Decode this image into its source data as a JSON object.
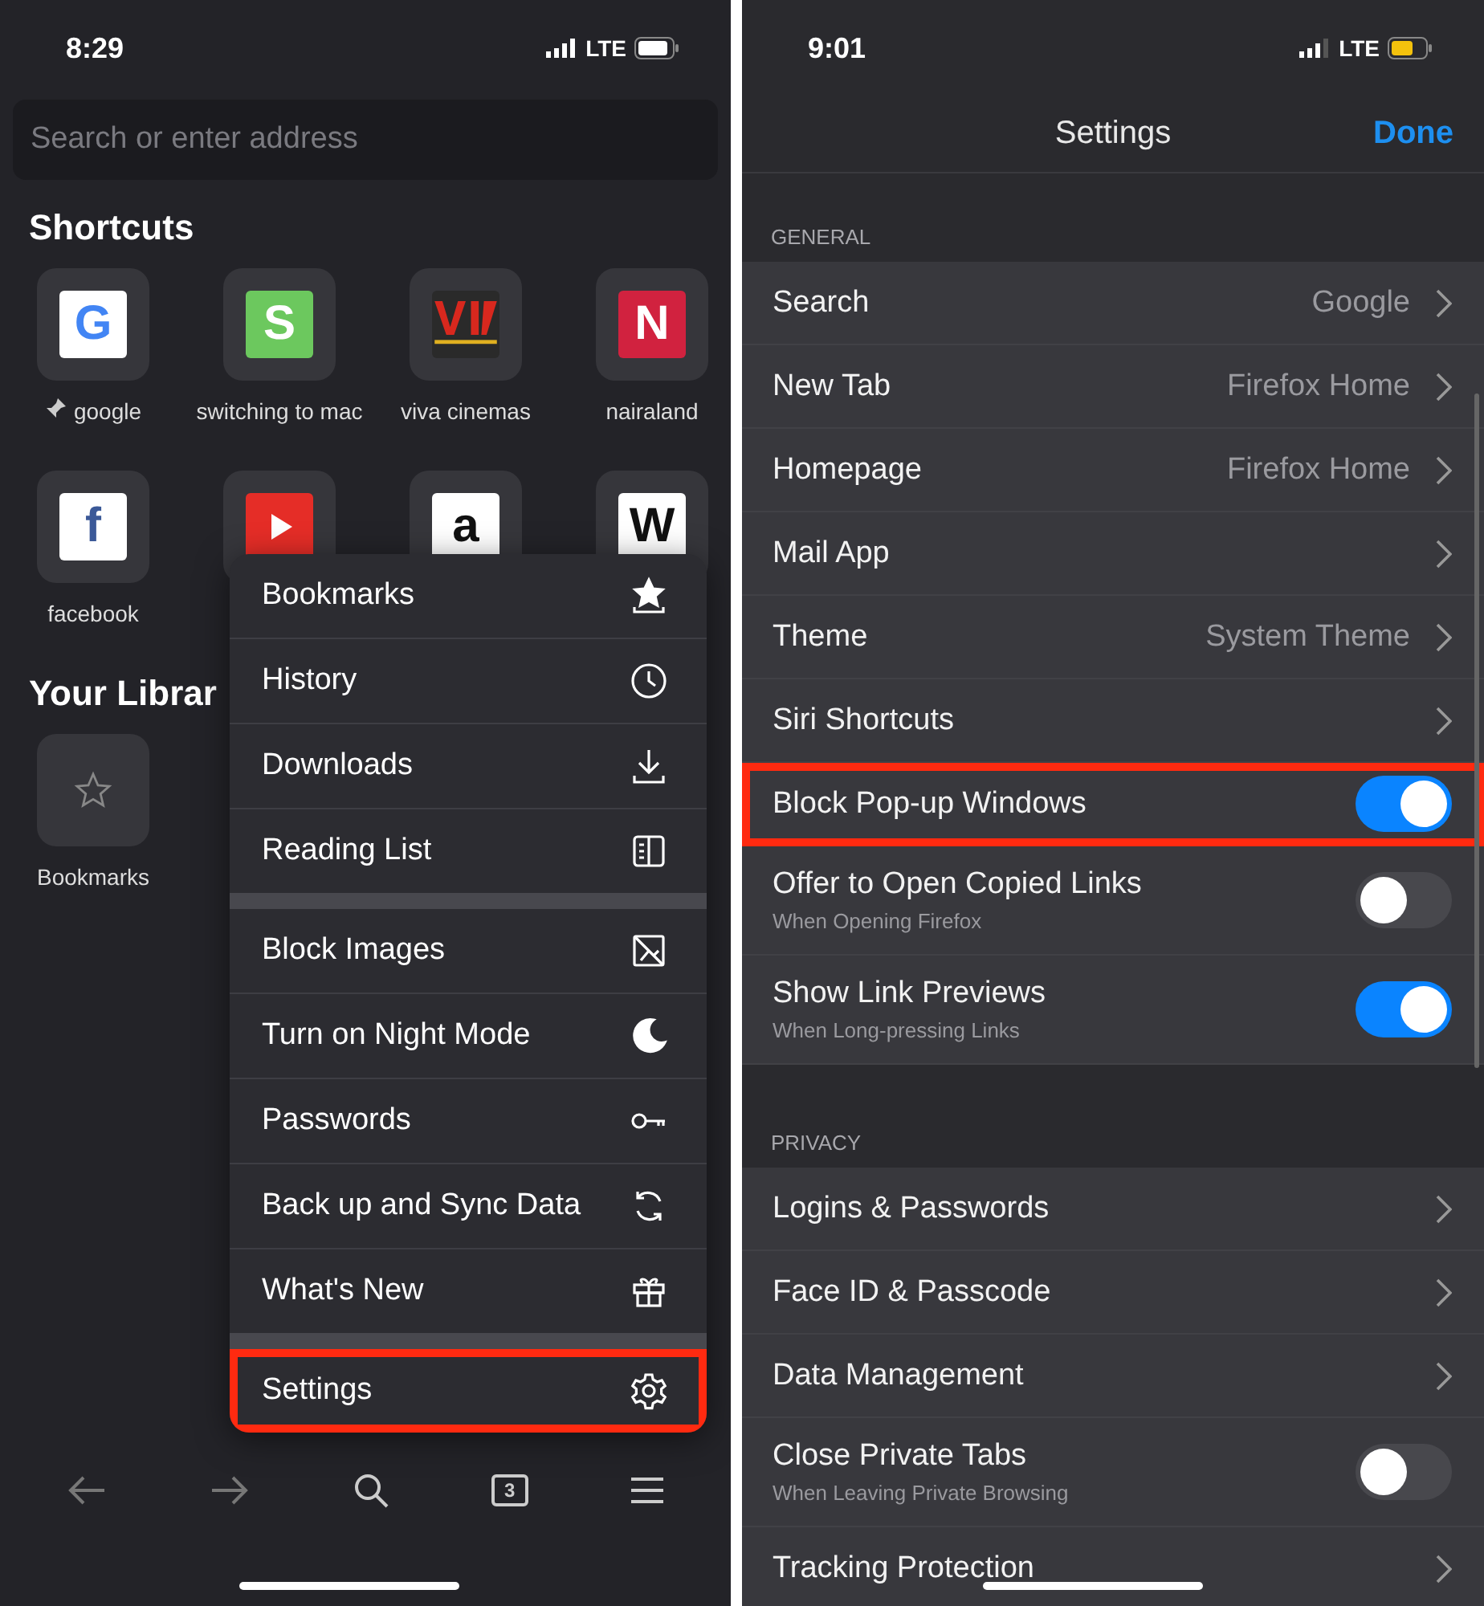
{
  "left_screen": {
    "status_bar": {
      "time": "8:29",
      "network": "LTE",
      "battery_saver": false
    },
    "search": {
      "placeholder": "Search or enter address"
    },
    "shortcuts_title": "Shortcuts",
    "shortcuts": [
      {
        "label": "google",
        "kind": "letter",
        "letter": {
          "text": "G",
          "color": "#4285f4"
        },
        "color": "#ffffff",
        "pinned": true
      },
      {
        "label": "switching to mac",
        "kind": "letter",
        "letter": {
          "text": "S",
          "color": "#ffffff"
        },
        "color": "#6cc85e",
        "pinned": false
      },
      {
        "label": "viva cinemas",
        "kind": "emblem",
        "color": "#2a2a2a",
        "pinned": false
      },
      {
        "label": "nairaland",
        "kind": "letter",
        "letter": {
          "text": "N",
          "color": "#ffffff"
        },
        "color": "#d1223f",
        "pinned": false
      },
      {
        "label": "facebook",
        "kind": "letter",
        "letter": {
          "text": "f",
          "color": "#3b5998"
        },
        "color": "#ffffff",
        "pinned": false
      },
      {
        "kind": "play",
        "color": "#e52d27"
      },
      {
        "kind": "letter",
        "letter": {
          "text": "a",
          "color": "#111111"
        },
        "color": "#ffffff"
      },
      {
        "kind": "letter",
        "letter": {
          "text": "W",
          "color": "#111111"
        },
        "color": "#ffffff"
      }
    ],
    "library_title": "Your Librar",
    "library": [
      {
        "label": "Bookmarks"
      }
    ],
    "menu": {
      "groups": [
        [
          {
            "label": "Bookmarks",
            "highlighted": false
          },
          {
            "label": "History",
            "highlighted": false
          },
          {
            "label": "Downloads",
            "highlighted": false
          },
          {
            "label": "Reading List",
            "highlighted": false
          }
        ],
        [
          {
            "label": "Block Images",
            "highlighted": false
          },
          {
            "label": "Turn on Night Mode",
            "highlighted": false
          },
          {
            "label": "Passwords",
            "highlighted": false
          },
          {
            "label": "Back up and Sync Data",
            "highlighted": false
          },
          {
            "label": "What's New",
            "highlighted": false
          }
        ],
        [
          {
            "label": "Settings",
            "highlighted": true
          }
        ]
      ]
    },
    "toolbar": {
      "tab_count": "3"
    }
  },
  "right_screen": {
    "status_bar": {
      "time": "9:01",
      "network": "LTE",
      "battery_saver": true
    },
    "title": "Settings",
    "done": "Done",
    "sections": [
      {
        "header": "GENERAL",
        "rows": [
          {
            "kind": "link",
            "label": "Search",
            "value": "Google",
            "highlighted": false
          },
          {
            "kind": "link",
            "label": "New Tab",
            "value": "Firefox Home",
            "highlighted": false
          },
          {
            "kind": "link",
            "label": "Homepage",
            "value": "Firefox Home",
            "highlighted": false
          },
          {
            "kind": "link",
            "label": "Mail App",
            "highlighted": false
          },
          {
            "kind": "link",
            "label": "Theme",
            "value": "System Theme",
            "highlighted": false
          },
          {
            "kind": "link",
            "label": "Siri Shortcuts",
            "highlighted": false
          },
          {
            "kind": "toggle",
            "label": "Block Pop-up Windows",
            "on": true,
            "highlighted": true
          },
          {
            "kind": "toggle",
            "label": "Offer to Open Copied Links",
            "subtitle": "When Opening Firefox",
            "on": false,
            "highlighted": false
          },
          {
            "kind": "toggle",
            "label": "Show Link Previews",
            "subtitle": "When Long-pressing Links",
            "on": true,
            "highlighted": false
          }
        ]
      },
      {
        "header": "PRIVACY",
        "rows": [
          {
            "kind": "link",
            "label": "Logins & Passwords",
            "highlighted": false
          },
          {
            "kind": "link",
            "label": "Face ID & Passcode",
            "highlighted": false
          },
          {
            "kind": "link",
            "label": "Data Management",
            "highlighted": false
          },
          {
            "kind": "toggle",
            "label": "Close Private Tabs",
            "subtitle": "When Leaving Private Browsing",
            "on": false,
            "highlighted": false
          },
          {
            "kind": "link",
            "label": "Tracking Protection",
            "highlighted": false
          }
        ]
      }
    ]
  }
}
